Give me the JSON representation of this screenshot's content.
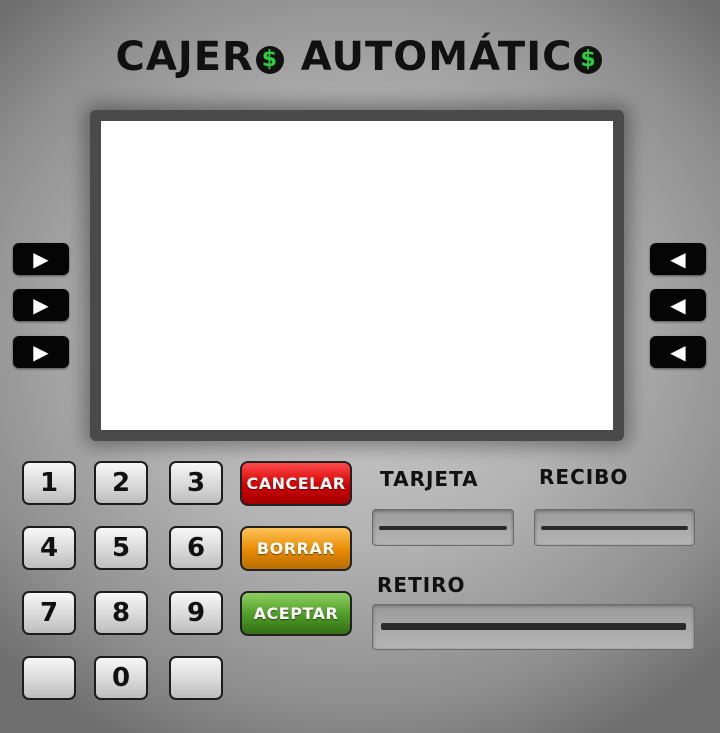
{
  "title": "CAJER",
  "title_coin": "$",
  "title_second": "AUTOMÁTIC",
  "title_coin2": "$",
  "side_buttons": {
    "left_glyph": "▶",
    "right_glyph": "◀"
  },
  "keypad": {
    "keys": [
      "1",
      "2",
      "3",
      "4",
      "5",
      "6",
      "7",
      "8",
      "9",
      "",
      "0",
      ""
    ]
  },
  "actions": {
    "cancel": "CANCELAR",
    "clear": "BORRAR",
    "accept": "ACEPTAR"
  },
  "slots": {
    "card": "TARJETA",
    "receipt": "RECIBO",
    "withdrawal": "RETIRO"
  },
  "colors": {
    "cancel": "#d00000",
    "clear": "#e68a00",
    "accept": "#4c9a25",
    "coin": "#2ecc40"
  }
}
